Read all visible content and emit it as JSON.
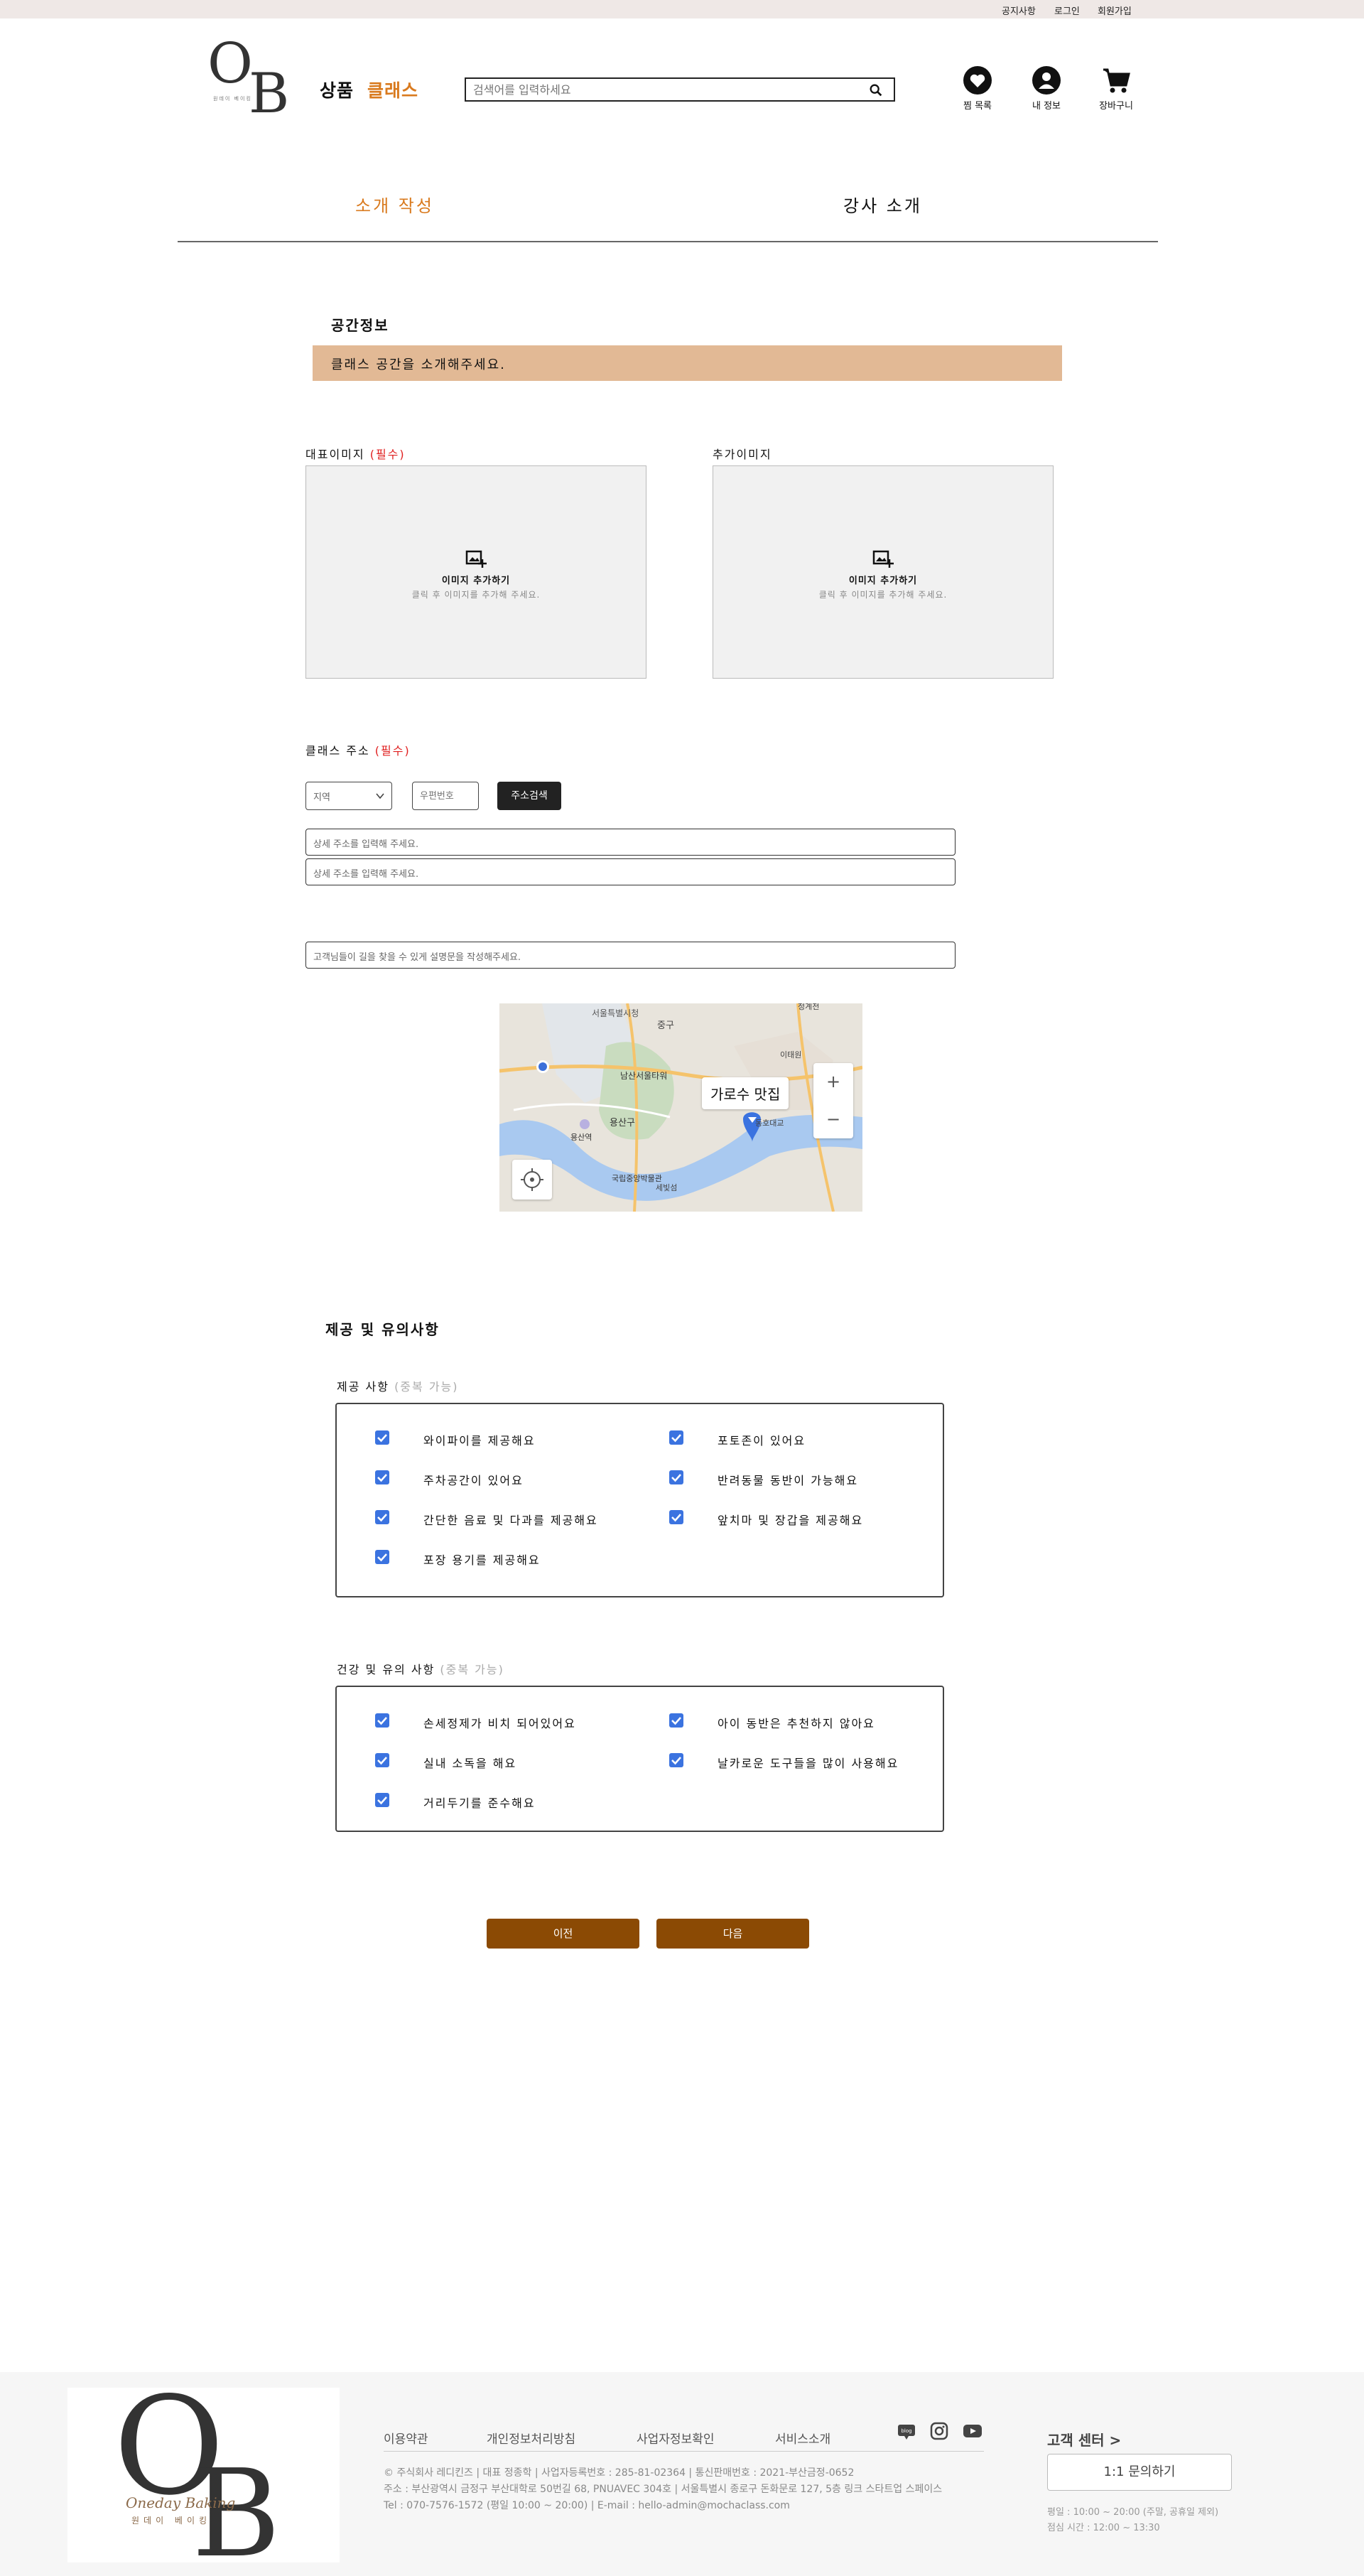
{
  "topbar": {
    "notice": "공지사항",
    "login": "로그인",
    "signup": "회원가입"
  },
  "header": {
    "logo_sub": "원데이 베이킹",
    "nav_products": "상품",
    "nav_classes": "클래스",
    "search_placeholder": "검색어를 입력하세요",
    "wishlist": "찜 목록",
    "myinfo": "내 정보",
    "cart": "장바구니"
  },
  "tabs": {
    "intro": "소개 작성",
    "instructor": "강사 소개"
  },
  "space": {
    "title": "공간정보",
    "banner": "클래스 공간을 소개해주세요.",
    "main_image_label": "대표이미지",
    "required": "(필수)",
    "extra_image_label": "추가이미지",
    "add_image": "이미지 추가하기",
    "add_image_hint": "클릭 후 이미지를 추가해 주세요."
  },
  "address": {
    "label": "클래스 주소",
    "required": "(필수)",
    "region_value": "지역",
    "zip_placeholder": "우편번호",
    "search_btn": "주소검색",
    "detail1_placeholder": "상세 주소를 입력해 주세요.",
    "detail2_placeholder": "상세 주소를 입력해 주세요.",
    "directions_placeholder": "고객님들이 길을 찾을 수 있게 설명문을 작성해주세요."
  },
  "map": {
    "place_label": "가로수 맛집",
    "labels": [
      "서울특별시청",
      "중구",
      "남산서울타워",
      "용산구",
      "용산역",
      "국립중앙박물관",
      "청계천",
      "이태원",
      "세빛섬",
      "동호대교"
    ],
    "zoom_in": "+",
    "zoom_out": "−"
  },
  "provision": {
    "title": "제공 및 유의사항",
    "offer_label": "제공 사항",
    "offer_opt": "(중복 가능)",
    "offers": [
      "와이파이를 제공해요",
      "포토존이 있어요",
      "주차공간이 있어요",
      "반려동물 동반이 가능해요",
      "간단한 음료 및 다과를 제공해요",
      "앞치마 및 장갑을 제공해요",
      "포장 용기를 제공해요"
    ],
    "health_label": "건강 및 유의 사항",
    "health_opt": "(중복 가능)",
    "health": [
      "손세정제가 비치 되어있어요",
      "아이 동반은 추천하지 않아요",
      "실내 소독을 해요",
      "날카로운 도구들을 많이 사용해요",
      "거리두기를 준수해요"
    ]
  },
  "buttons": {
    "prev": "이전",
    "next": "다음"
  },
  "footer": {
    "logo_sub": "원데이 베이킹",
    "logo_script": "Oneday Baking",
    "links": [
      "이용약관",
      "개인정보처리방침",
      "사업자정보확인",
      "서비스소개"
    ],
    "info1": "© 주식회사 레디킨즈 | 대표 정종학 | 사업자등록번호 : 285-81-02364 | 통신판매번호 : 2021-부산금정-0652",
    "info2": "주소 : 부산광역시 금정구 부산대학로 50번길 68, PNUAVEC 304호 | 서울특별시 종로구 돈화문로 127, 5층 링크 스타트업 스페이스",
    "info3": "Tel : 070-7576-1572 (평일 10:00 ~ 20:00) | E-mail : hello-admin@mochaclass.com",
    "cs_title": "고객 센터 >",
    "cs_btn": "1:1 문의하기",
    "cs_hours": "평일 : 10:00 ~ 20:00 (주말, 공휴일 제외)",
    "cs_lunch": "점심 시간 : 12:00 ~ 13:30",
    "blog": "blog"
  },
  "colors": {
    "accent": "#d97a1e",
    "banner": "#e2b995",
    "checkbox": "#3b73e0",
    "button": "#8b4a04",
    "topbar": "#efe8e6"
  }
}
